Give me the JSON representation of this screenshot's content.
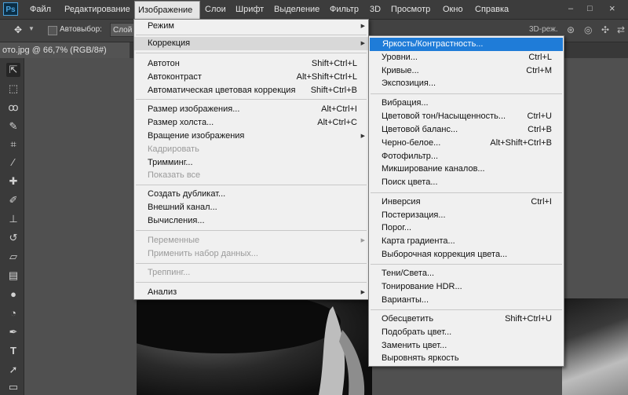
{
  "app": {
    "logo": "Ps"
  },
  "menubar": [
    "Файл",
    "Редактирование",
    "Изображение",
    "Слои",
    "Шрифт",
    "Выделение",
    "Фильтр",
    "3D",
    "Просмотр",
    "Окно",
    "Справка"
  ],
  "window_controls": [
    "–",
    "□",
    "×"
  ],
  "options_bar": {
    "autoselect_label": "Автовыбор:",
    "layer_select": "Слой",
    "mode_3d": "3D-реж."
  },
  "document": {
    "tab_title": "ото.jpg @ 66,7% (RGB/8#)"
  },
  "icons": [
    "move-icon",
    "marquee-icon",
    "lasso-icon",
    "quick-select-icon",
    "crop-icon",
    "eyedropper-icon",
    "healing-brush-icon",
    "brush-icon",
    "clone-stamp-icon",
    "history-brush-icon",
    "eraser-icon",
    "gradient-icon",
    "blur-icon",
    "dodge-icon",
    "pen-icon",
    "type-icon",
    "path-select-icon",
    "shape-icon"
  ],
  "image_menu": {
    "mode": "Режим",
    "adjustments": "Коррекция",
    "auto_tone": {
      "label": "Автотон",
      "shortcut": "Shift+Ctrl+L"
    },
    "auto_contrast": {
      "label": "Автоконтраст",
      "shortcut": "Alt+Shift+Ctrl+L"
    },
    "auto_color": {
      "label": "Автоматическая цветовая коррекция",
      "shortcut": "Shift+Ctrl+B"
    },
    "image_size": {
      "label": "Размер изображения...",
      "shortcut": "Alt+Ctrl+I"
    },
    "canvas_size": {
      "label": "Размер холста...",
      "shortcut": "Alt+Ctrl+C"
    },
    "image_rotation": "Вращение изображения",
    "crop": "Кадрировать",
    "trim": "Тримминг...",
    "reveal_all": "Показать все",
    "duplicate": "Создать дубликат...",
    "apply_image": "Внешний канал...",
    "calculations": "Вычисления...",
    "variables": "Переменные",
    "apply_data_set": "Применить набор данных...",
    "trap": "Треппинг...",
    "analysis": "Анализ"
  },
  "adjustments_menu": {
    "brightness_contrast": "Яркость/Контрастность...",
    "levels": {
      "label": "Уровни...",
      "shortcut": "Ctrl+L"
    },
    "curves": {
      "label": "Кривые...",
      "shortcut": "Ctrl+M"
    },
    "exposure": "Экспозиция...",
    "vibrance": "Вибрация...",
    "hue_saturation": {
      "label": "Цветовой тон/Насыщенность...",
      "shortcut": "Ctrl+U"
    },
    "color_balance": {
      "label": "Цветовой баланс...",
      "shortcut": "Ctrl+B"
    },
    "black_white": {
      "label": "Черно-белое...",
      "shortcut": "Alt+Shift+Ctrl+B"
    },
    "photo_filter": "Фотофильтр...",
    "channel_mixer": "Микширование каналов...",
    "color_lookup": "Поиск цвета...",
    "invert": {
      "label": "Инверсия",
      "shortcut": "Ctrl+I"
    },
    "posterize": "Постеризация...",
    "threshold": "Порог...",
    "gradient_map": "Карта градиента...",
    "selective_color": "Выборочная коррекция цвета...",
    "shadows_highlights": "Тени/Света...",
    "hdr_toning": "Тонирование HDR...",
    "variations": "Варианты...",
    "desaturate": {
      "label": "Обесцветить",
      "shortcut": "Shift+Ctrl+U"
    },
    "match_color": "Подобрать цвет...",
    "replace_color": "Заменить цвет...",
    "equalize": "Выровнять яркость"
  },
  "colors": {
    "highlight": "#1f7cd8",
    "menu_bg": "#f0f0f0",
    "chrome": "#3c3c3c",
    "disabled": "#9a9a9a"
  }
}
